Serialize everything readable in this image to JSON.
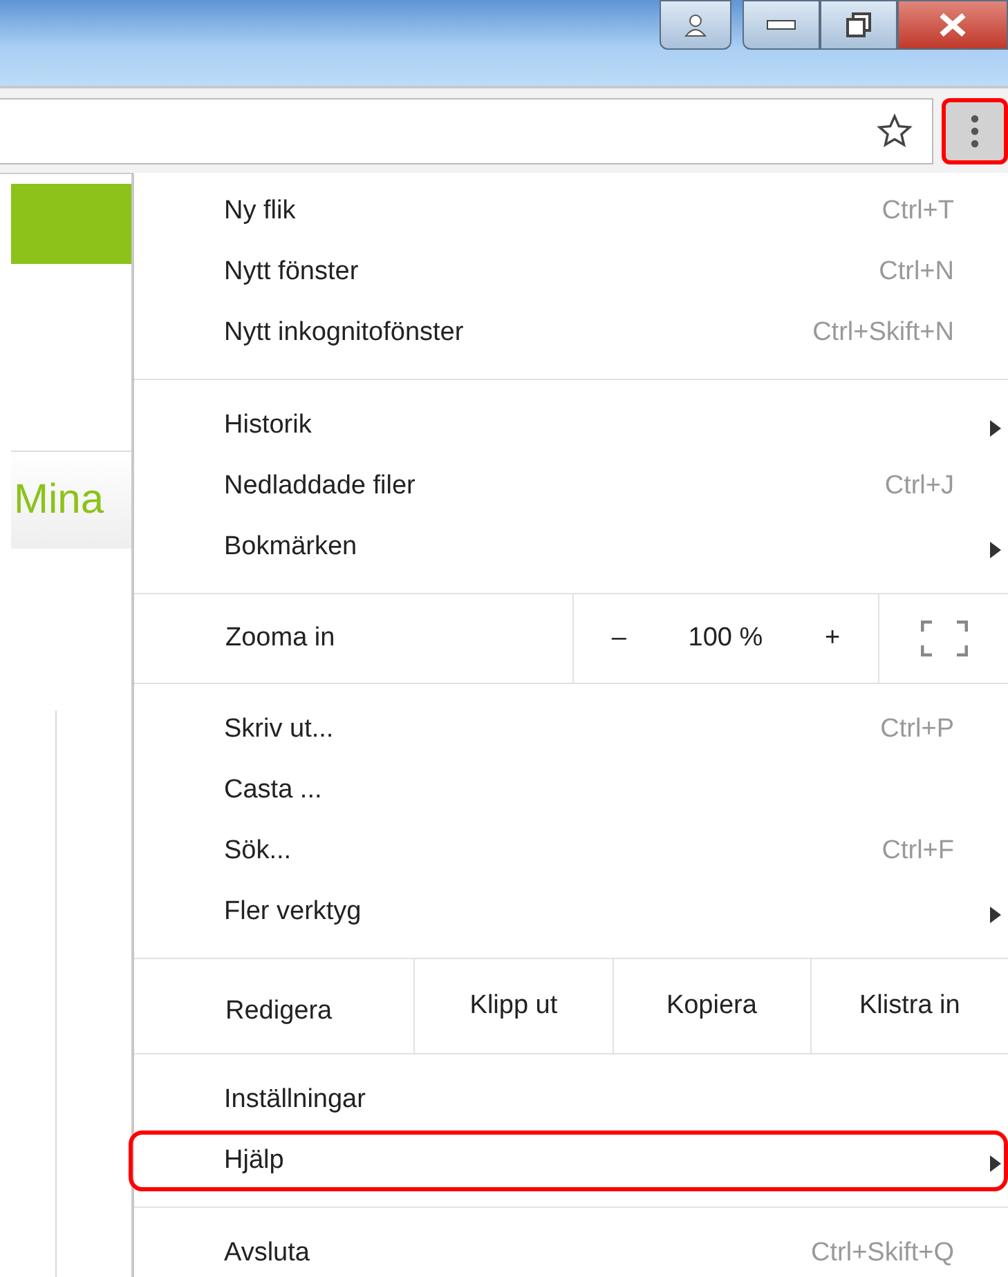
{
  "page": {
    "heading": "Mina"
  },
  "toolbar": {
    "menu_button_highlighted": true
  },
  "menu": {
    "sections": [
      {
        "kind": "items",
        "items": [
          {
            "label": "Ny flik",
            "shortcut": "Ctrl+T",
            "submenu": false,
            "highlighted": false
          },
          {
            "label": "Nytt fönster",
            "shortcut": "Ctrl+N",
            "submenu": false,
            "highlighted": false
          },
          {
            "label": "Nytt inkognitofönster",
            "shortcut": "Ctrl+Skift+N",
            "submenu": false,
            "highlighted": false
          }
        ]
      },
      {
        "kind": "items",
        "items": [
          {
            "label": "Historik",
            "submenu": true,
            "highlighted": false
          },
          {
            "label": "Nedladdade filer",
            "shortcut": "Ctrl+J",
            "submenu": false,
            "highlighted": false
          },
          {
            "label": "Bokmärken",
            "submenu": true,
            "highlighted": false
          }
        ]
      },
      {
        "kind": "zoom",
        "label": "Zooma in",
        "minus": "–",
        "value": "100 %",
        "plus": "+"
      },
      {
        "kind": "items",
        "items": [
          {
            "label": "Skriv ut...",
            "shortcut": "Ctrl+P",
            "submenu": false,
            "highlighted": false
          },
          {
            "label": "Casta ...",
            "submenu": false,
            "highlighted": false
          },
          {
            "label": "Sök...",
            "shortcut": "Ctrl+F",
            "submenu": false,
            "highlighted": false
          },
          {
            "label": "Fler verktyg",
            "submenu": true,
            "highlighted": false
          }
        ]
      },
      {
        "kind": "edit",
        "label": "Redigera",
        "buttons": [
          "Klipp ut",
          "Kopiera",
          "Klistra in"
        ]
      },
      {
        "kind": "items",
        "items": [
          {
            "label": "Inställningar",
            "submenu": false,
            "highlighted": false
          },
          {
            "label": "Hjälp",
            "submenu": true,
            "highlighted": true
          }
        ]
      },
      {
        "kind": "items",
        "items": [
          {
            "label": "Avsluta",
            "shortcut": "Ctrl+Skift+Q",
            "submenu": false,
            "highlighted": false
          }
        ]
      }
    ]
  }
}
